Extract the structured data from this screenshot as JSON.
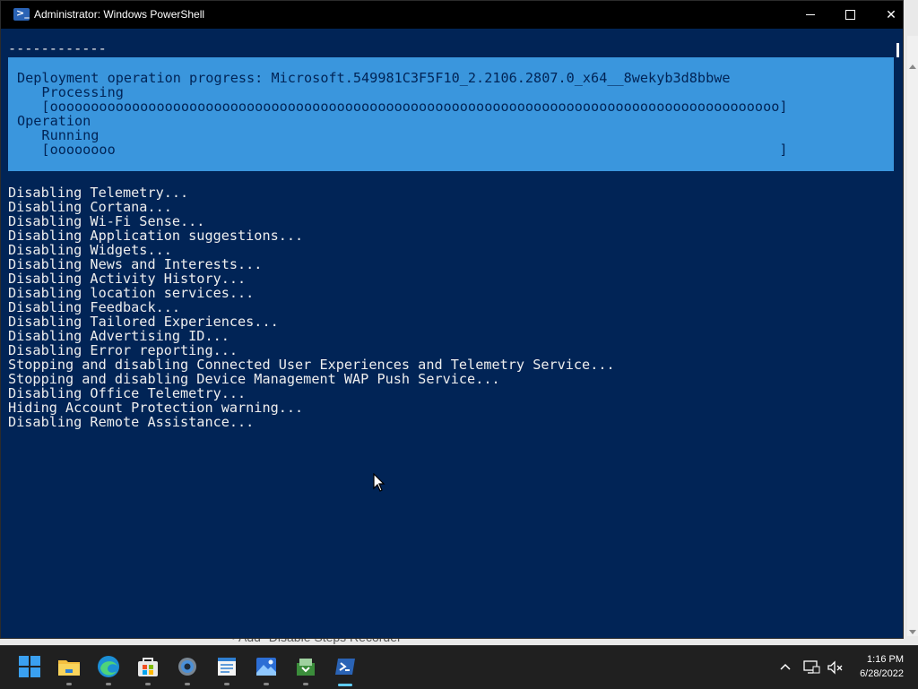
{
  "window": {
    "title": "Administrator: Windows PowerShell"
  },
  "console": {
    "separator": "------------",
    "progress": {
      "line1": "Deployment operation progress: Microsoft.549981C3F5F10_2.2106.2807.0_x64__8wekyb3d8bbwe",
      "line2": "   Processing",
      "line3": "   [ooooooooooooooooooooooooooooooooooooooooooooooooooooooooooooooooooooooooooooooooooooooooo]",
      "line4": "Operation",
      "line5": "   Running",
      "line6": "   [oooooooo                                                                                 ]"
    },
    "output": [
      "Disabling Telemetry...",
      "Disabling Cortana...",
      "Disabling Wi-Fi Sense...",
      "Disabling Application suggestions...",
      "Disabling Widgets...",
      "Disabling News and Interests...",
      "Disabling Activity History...",
      "Disabling location services...",
      "Disabling Feedback...",
      "Disabling Tailored Experiences...",
      "Disabling Advertising ID...",
      "Disabling Error reporting...",
      "Stopping and disabling Connected User Experiences and Telemetry Service...",
      "Stopping and disabling Device Management WAP Push Service...",
      "Disabling Office Telemetry...",
      "Hiding Account Protection warning...",
      "Disabling Remote Assistance..."
    ]
  },
  "background_window": {
    "text": "•   Add \"Disable Steps Recorder\""
  },
  "taskbar": {
    "icons": [
      "start-icon",
      "file-explorer-icon",
      "edge-icon",
      "store-icon",
      "settings-icon",
      "notepad-icon",
      "photos-icon",
      "app-icon",
      "powershell-icon"
    ],
    "clock_time": "1:16 PM",
    "clock_date": "6/28/2022"
  },
  "colors": {
    "console_bg": "#012456",
    "progress_bg": "#3a96dd",
    "accent": "#60cdff"
  }
}
